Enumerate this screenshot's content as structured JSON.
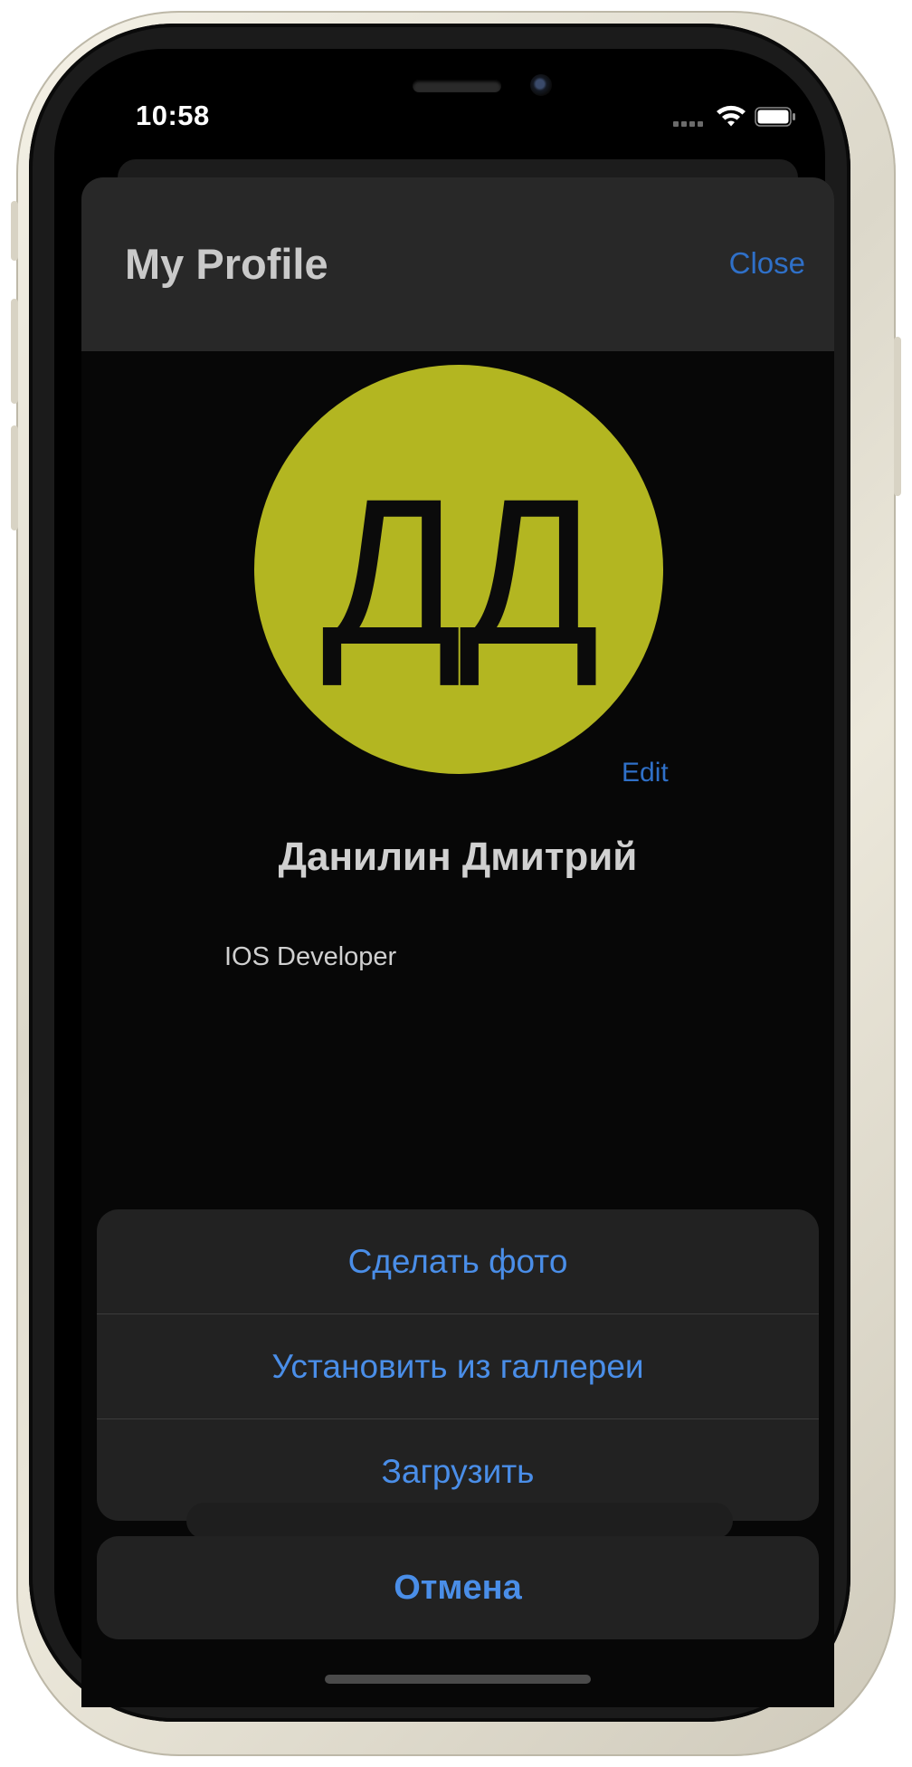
{
  "status_bar": {
    "time": "10:58",
    "signal_icon": "cellular-signal-icon",
    "wifi_icon": "wifi-icon",
    "battery_icon": "battery-icon"
  },
  "profile": {
    "nav_title": "My Profile",
    "close_label": "Close",
    "avatar_initials": "ДД",
    "avatar_color": "#b3b621",
    "edit_label": "Edit",
    "full_name": "Данилин Дмитрий",
    "job_title": "IOS Developer"
  },
  "action_sheet": {
    "items": [
      {
        "label": "Сделать фото"
      },
      {
        "label": "Установить из галлереи"
      },
      {
        "label": "Загрузить"
      }
    ],
    "cancel_label": "Отмена",
    "accent_color": "#4a8ee8"
  }
}
